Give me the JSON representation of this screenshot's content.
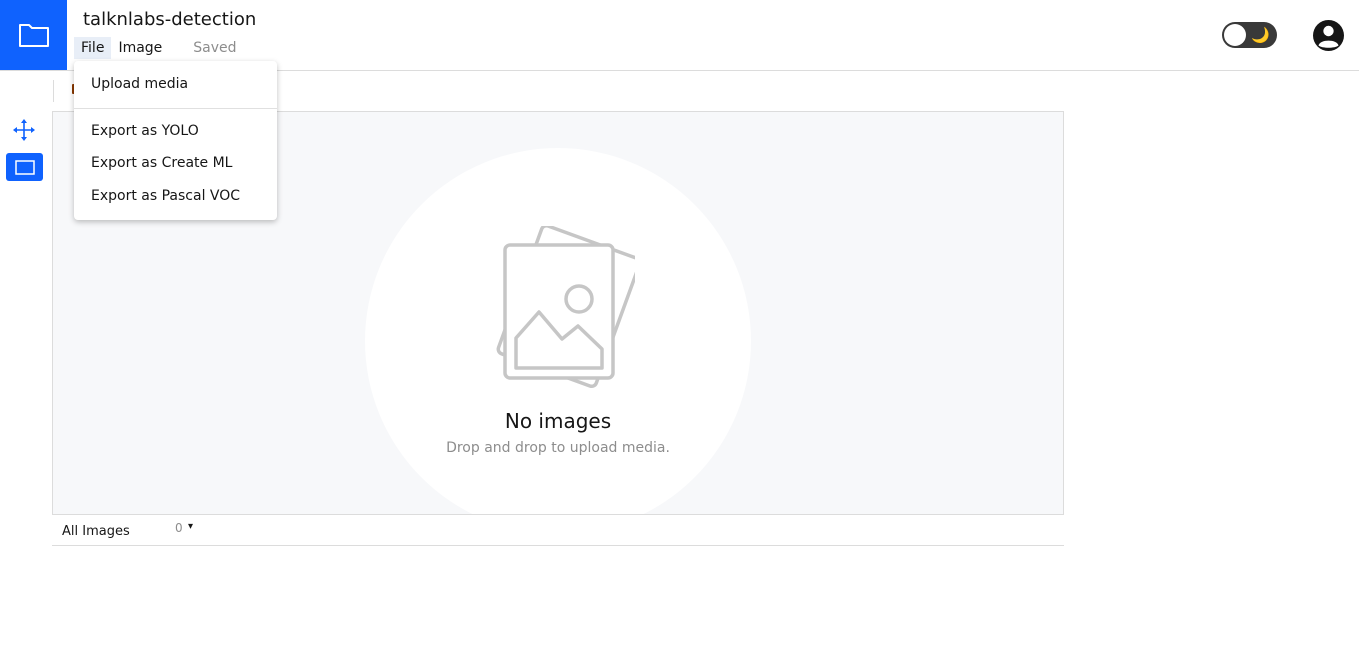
{
  "header": {
    "project_title": "talknlabs-detection",
    "menu": {
      "file": "File",
      "image": "Image"
    },
    "saved_status": "Saved",
    "theme_toggle": {
      "icon": "moon-icon",
      "glyph": "🌙",
      "dark_mode": false
    },
    "icons": {
      "logo": "folder-icon",
      "account": "user-avatar-icon"
    }
  },
  "toolbar": {
    "tools": [
      {
        "name": "move",
        "icon": "move-arrows-icon",
        "active": false
      },
      {
        "name": "bounding-box",
        "icon": "rectangle-icon",
        "active": true
      }
    ]
  },
  "file_menu": {
    "items": [
      "Upload media",
      "Export as YOLO",
      "Export as Create ML",
      "Export as Pascal VOC"
    ]
  },
  "canvas": {
    "empty_title": "No images",
    "empty_subtitle": "Drop and drop to upload media.",
    "icon": "image-stack-icon"
  },
  "image_list": {
    "filter_label": "All Images",
    "count": "0",
    "caret": "▾"
  },
  "colors": {
    "accent": "#0f62fe",
    "canvas_background": "#f7f8fa",
    "toggle_track": "#393939",
    "moon": "#f1c21b"
  }
}
